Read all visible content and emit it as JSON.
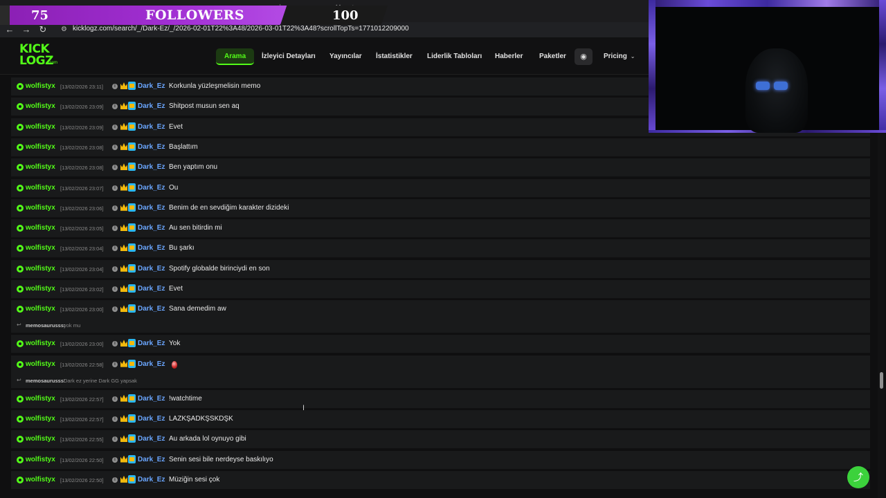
{
  "browser": {
    "url": "kicklogz.com/search/_/Dark-Ez/_/2026-02-01T22%3A48/2026-03-01T22%3A48?scrollTopTs=1771012209000",
    "ghost_tab_text": "rch"
  },
  "overlay": {
    "current": "75",
    "title": "FOLLOWERS",
    "goal": "100"
  },
  "header": {
    "logo_line1": "KICK",
    "logo_line2": "LOGZ",
    "logo_suffix": ".com",
    "menu": [
      {
        "label": "Arama"
      },
      {
        "label": "İzleyici Detayları"
      },
      {
        "label": "Yayıncılar"
      },
      {
        "label": "İstatistikler"
      },
      {
        "label": "Liderlik Tabloları"
      },
      {
        "label": "Haberler"
      },
      {
        "label": "Paketler"
      },
      {
        "label": "Pricing"
      }
    ],
    "discord_icon": "discord-icon",
    "pricing_chevron": "chevron-down-icon"
  },
  "chat": {
    "channel": "wolfistyx",
    "user": "Dark_Ez",
    "rows": [
      {
        "ts": "[13/02/2026 23:11]",
        "msg": "Korkunla yüzleşmelisin memo"
      },
      {
        "ts": "[13/02/2026 23:09]",
        "msg": "Shitpost musun sen aq"
      },
      {
        "ts": "[13/02/2026 23:09]",
        "msg": "Evet"
      },
      {
        "ts": "[13/02/2026 23:08]",
        "msg": "Başlattım"
      },
      {
        "ts": "[13/02/2026 23:08]",
        "msg": "Ben yaptım onu"
      },
      {
        "ts": "[13/02/2026 23:07]",
        "msg": "Ou"
      },
      {
        "ts": "[13/02/2026 23:06]",
        "msg": "Benim de en sevdiğim karakter dizideki"
      },
      {
        "ts": "[13/02/2026 23:05]",
        "msg": "Au sen bitirdin mi"
      },
      {
        "ts": "[13/02/2026 23:04]",
        "msg": "Bu şarkı"
      },
      {
        "ts": "[13/02/2026 23:04]",
        "msg": "Spotify globalde birinciydi en son"
      },
      {
        "ts": "[13/02/2026 23:02]",
        "msg": "Evet"
      },
      {
        "ts": "[13/02/2026 23:00]",
        "msg": "Sana demedim aw",
        "reply_user": "memosaurusss:",
        "reply_text": "yok mu"
      },
      {
        "ts": "[13/02/2026 23:00]",
        "msg": "Yok"
      },
      {
        "ts": "[13/02/2026 22:58]",
        "msg": "",
        "emoji": "red-heart-emoji",
        "reply_user": "memosaurusss:",
        "reply_text": "Dark ez yerine Dark GG yapsak"
      },
      {
        "ts": "[13/02/2026 22:57]",
        "msg": "!watchtime"
      },
      {
        "ts": "[13/02/2026 22:57]",
        "msg": "LAZKŞADKŞSKDŞK"
      },
      {
        "ts": "[13/02/2026 22:55]",
        "msg": "Au arkada lol oynuyo gibi"
      },
      {
        "ts": "[13/02/2026 22:50]",
        "msg": "Senin sesi bile nerdeyse baskılıyo"
      },
      {
        "ts": "[13/02/2026 22:50]",
        "msg": "Müziğin sesi çok"
      }
    ]
  },
  "colors": {
    "kick_green": "#53fc18",
    "user_blue": "#6aa6ff",
    "overlay_purple": "#a230d4",
    "share_green": "#3cd23c"
  },
  "icons": {
    "share": "share-icon",
    "back": "back-arrow-icon",
    "forward": "forward-arrow-icon",
    "reload": "reload-icon"
  }
}
